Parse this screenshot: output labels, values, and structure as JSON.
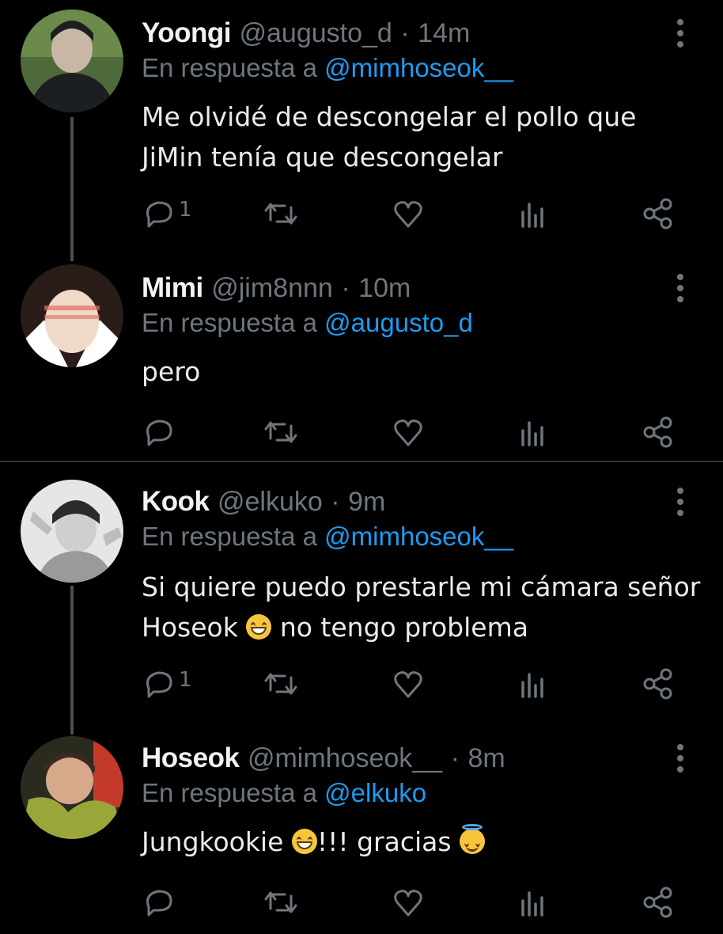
{
  "tweets": [
    {
      "name": "Yoongi",
      "handle": "@augusto_d",
      "separator": "·",
      "time": "14m",
      "reply_prefix": "En respuesta a",
      "reply_to": "@mimhoseok__",
      "lines": [
        "Me olvidé de descongelar el pollo que",
        "JiMin tenía que descongelar"
      ],
      "reply_count": "1",
      "avatar_colors": [
        "#4f6a3a",
        "#1b1f22",
        "#c9b7a6"
      ]
    },
    {
      "name": "Mimi",
      "handle": "@jim8nnn",
      "separator": "·",
      "time": "10m",
      "reply_prefix": "En respuesta a",
      "reply_to": "@augusto_d",
      "lines": [
        "pero"
      ],
      "reply_count": "",
      "avatar_colors": [
        "#2a1c18",
        "#f0d9c7",
        "#ffffff"
      ]
    },
    {
      "name": "Kook",
      "handle": "@elkuko",
      "separator": "·",
      "time": "9m",
      "reply_prefix": "En respuesta a",
      "reply_to": "@mimhoseok__",
      "lines": [
        "Si quiere puedo prestarle mi cámara señor",
        "Hoseok",
        "no tengo problema"
      ],
      "reply_count": "1",
      "avatar_colors": [
        "#e6e6e6",
        "#2b2b2b",
        "#9a9a9a"
      ]
    },
    {
      "name": "Hoseok",
      "handle": "@mimhoseok__",
      "separator": "·",
      "time": "8m",
      "reply_prefix": "En respuesta a",
      "reply_to": "@elkuko",
      "lines": [
        "Jungkookie",
        "!!! gracias"
      ],
      "reply_count": "",
      "avatar_colors": [
        "#9aa53a",
        "#3a2a1f",
        "#c43a2a"
      ]
    }
  ],
  "icons": [
    "reply-icon",
    "retweet-icon",
    "like-icon",
    "analytics-icon",
    "share-icon",
    "more-icon",
    "grinning-emoji",
    "halo-emoji"
  ],
  "colors": {
    "background": "#000000",
    "muted": "#6e767d",
    "mention": "#1d9bf0",
    "text": "#e7e9ea",
    "thread_line": "#4a4f54"
  }
}
